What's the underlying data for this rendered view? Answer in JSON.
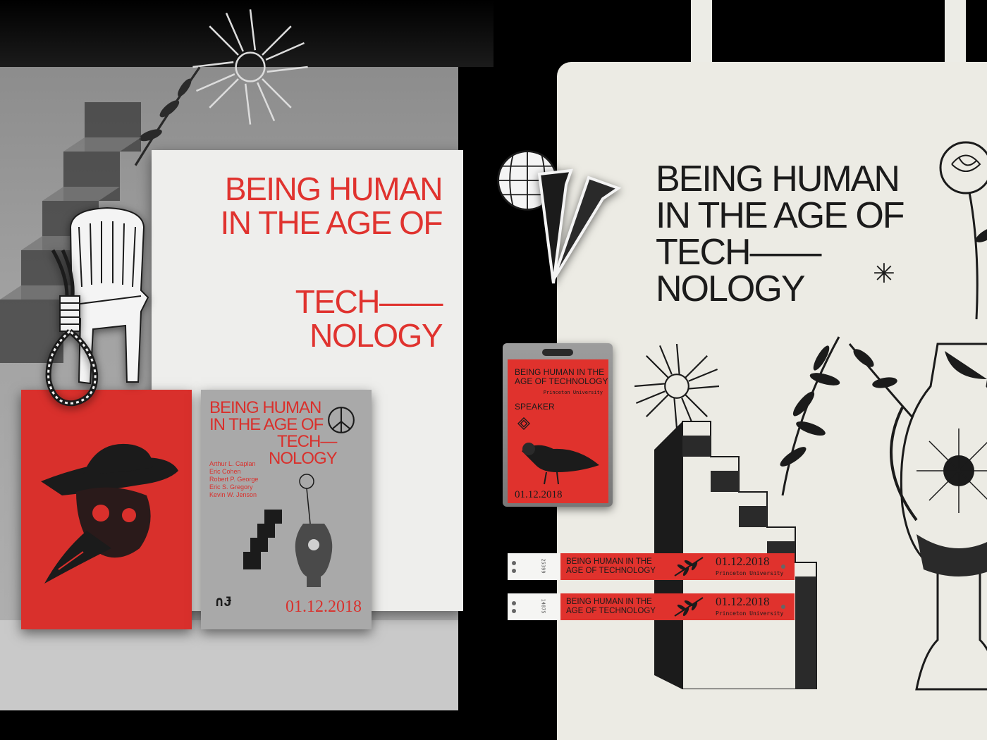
{
  "colors": {
    "accent_red": "#e0322d",
    "ink": "#1b1b1b",
    "paper": "#eeeeec",
    "canvas": "#ecebe4",
    "background": "#000000"
  },
  "poster": {
    "line1": "BEING HUMAN",
    "line2": "IN THE AGE OF",
    "line3": "TECH——",
    "line4": "NOLOGY"
  },
  "flyer": {
    "line1": "BEING HUMAN",
    "line2": "IN THE AGE OF",
    "line3": "TECH—",
    "line4": "NOLOGY",
    "speakers": [
      "Arthur L. Caplan",
      "Eric Cohen",
      "Robert P. George",
      "Eric S. Gregory",
      "Kevin W. Jenson"
    ],
    "date": "01.12.2018"
  },
  "tote": {
    "line1": "BEING HUMAN",
    "line2": "IN THE AGE OF",
    "line3": "TECH——",
    "line4": "NOLOGY"
  },
  "badge": {
    "title_line1": "BEING HUMAN IN THE",
    "title_line2": "AGE OF TECHNOLOGY",
    "institution": "Princeton University",
    "role": "SPEAKER",
    "date": "01.12.2018"
  },
  "wristbands": [
    {
      "serial": "25399",
      "line1": "BEING HUMAN IN THE",
      "line2": "AGE OF TECHNOLOGY",
      "date": "01.12.2018",
      "institution": "Princeton University"
    },
    {
      "serial": "14875",
      "line1": "BEING HUMAN IN THE",
      "line2": "AGE OF TECHNOLOGY",
      "date": "01.12.2018",
      "institution": "Princeton University"
    }
  ],
  "icons": [
    "starburst-icon",
    "leaf-branch-icon",
    "staircase-icon",
    "vase-icon",
    "rose-icon",
    "sparkle-icon",
    "chair-icon",
    "noose-icon",
    "skull-icon",
    "disco-ball-icon",
    "nails-icon",
    "pigeon-icon",
    "peace-icon"
  ]
}
